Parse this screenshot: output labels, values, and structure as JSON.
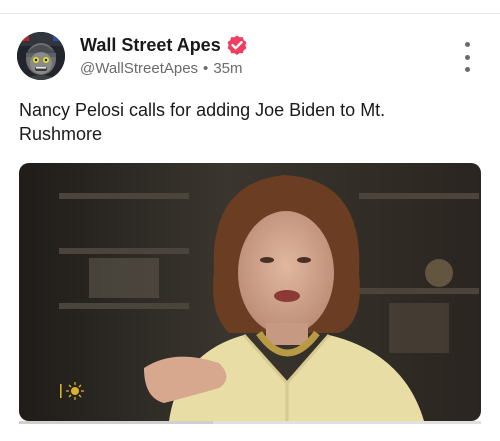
{
  "post": {
    "author_name": "Wall Street Apes",
    "verified": true,
    "handle": "@WallStreetApes",
    "separator": "•",
    "timestamp": "35m",
    "text": "Nancy Pelosi calls for adding Joe Biden to Mt. Rushmore",
    "media": {
      "type": "video",
      "progress_fraction": 0.42
    }
  },
  "icons": {
    "verified": "verified-badge-icon",
    "more": "more-vertical-icon"
  },
  "colors": {
    "verified_badge": "#ef3e64",
    "name_text": "#1a1a1a",
    "muted_text": "#6b6b6b",
    "divider": "#e7e7ea"
  }
}
